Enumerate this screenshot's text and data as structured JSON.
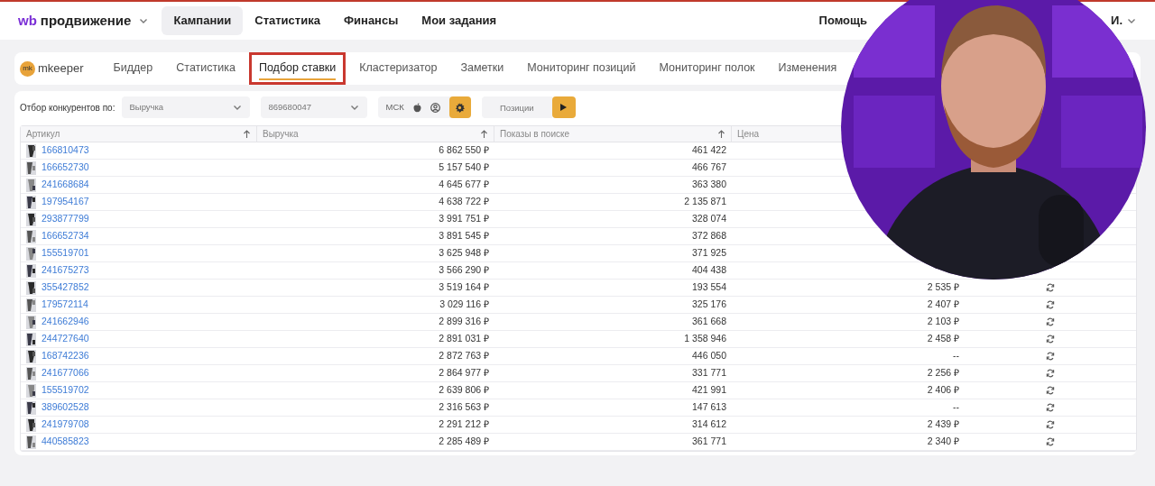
{
  "top_nav": {
    "logo": {
      "mark": "wb",
      "text": "продвижение"
    },
    "items": [
      {
        "label": "Кампании",
        "selected": true
      },
      {
        "label": "Статистика",
        "selected": false
      },
      {
        "label": "Финансы",
        "selected": false
      },
      {
        "label": "Мои задания",
        "selected": false
      }
    ],
    "help": "Помощь",
    "user": "И."
  },
  "tool": {
    "logo": {
      "mark": "mk",
      "text": "mkeeper"
    },
    "tabs": [
      {
        "label": "Биддер",
        "selected": false,
        "highlighted": false
      },
      {
        "label": "Статистика",
        "selected": false,
        "highlighted": false
      },
      {
        "label": "Подбор ставки",
        "selected": true,
        "highlighted": true
      },
      {
        "label": "Кластеризатор",
        "selected": false,
        "highlighted": false
      },
      {
        "label": "Заметки",
        "selected": false,
        "highlighted": false
      },
      {
        "label": "Мониторинг позиций",
        "selected": false,
        "highlighted": false
      },
      {
        "label": "Мониторинг полок",
        "selected": false,
        "highlighted": false
      },
      {
        "label": "Изменения",
        "selected": false,
        "highlighted": false
      }
    ]
  },
  "filter": {
    "label": "Отбор конкурентов по:",
    "metric": "Выручка",
    "article": "869680047",
    "region": "МСК",
    "positions_placeholder": "Позиции"
  },
  "table": {
    "columns": [
      {
        "label": "Артикул",
        "sort_arrow": true
      },
      {
        "label": "Выручка",
        "sort_arrow": true
      },
      {
        "label": "Показы в поиске",
        "sort_arrow": true
      },
      {
        "label": "Цена",
        "sort_arrow": false
      }
    ],
    "rows": [
      {
        "article": "166810473",
        "revenue": "6 862 550 ₽",
        "impressions": "461 422"
      },
      {
        "article": "166652730",
        "revenue": "5 157 540 ₽",
        "impressions": "466 767"
      },
      {
        "article": "241668684",
        "revenue": "4 645 677 ₽",
        "impressions": "363 380"
      },
      {
        "article": "197954167",
        "revenue": "4 638 722 ₽",
        "impressions": "2 135 871"
      },
      {
        "article": "293877799",
        "revenue": "3 991 751 ₽",
        "impressions": "328 074"
      },
      {
        "article": "166652734",
        "revenue": "3 891 545 ₽",
        "impressions": "372 868"
      },
      {
        "article": "155519701",
        "revenue": "3 625 948 ₽",
        "impressions": "371 925"
      },
      {
        "article": "241675273",
        "revenue": "3 566 290 ₽",
        "impressions": "404 438"
      },
      {
        "article": "355427852",
        "revenue": "3 519 164 ₽",
        "impressions": "193 554",
        "price": "2 535 ₽"
      },
      {
        "article": "179572114",
        "revenue": "3 029 116 ₽",
        "impressions": "325 176",
        "price": "2 407 ₽"
      },
      {
        "article": "241662946",
        "revenue": "2 899 316 ₽",
        "impressions": "361 668",
        "price": "2 103 ₽"
      },
      {
        "article": "244727640",
        "revenue": "2 891 031 ₽",
        "impressions": "1 358 946",
        "price": "2 458 ₽"
      },
      {
        "article": "168742236",
        "revenue": "2 872 763 ₽",
        "impressions": "446 050",
        "price": "--"
      },
      {
        "article": "241677066",
        "revenue": "2 864 977 ₽",
        "impressions": "331 771",
        "price": "2 256 ₽"
      },
      {
        "article": "155519702",
        "revenue": "2 639 806 ₽",
        "impressions": "421 991",
        "price": "2 406 ₽"
      },
      {
        "article": "389602528",
        "revenue": "2 316 563 ₽",
        "impressions": "147 613",
        "price": "--"
      },
      {
        "article": "241979708",
        "revenue": "2 291 212 ₽",
        "impressions": "314 612",
        "price": "2 439 ₽"
      },
      {
        "article": "440585823",
        "revenue": "2 285 489 ₽",
        "impressions": "361 771",
        "price": "2 340 ₽"
      }
    ]
  }
}
